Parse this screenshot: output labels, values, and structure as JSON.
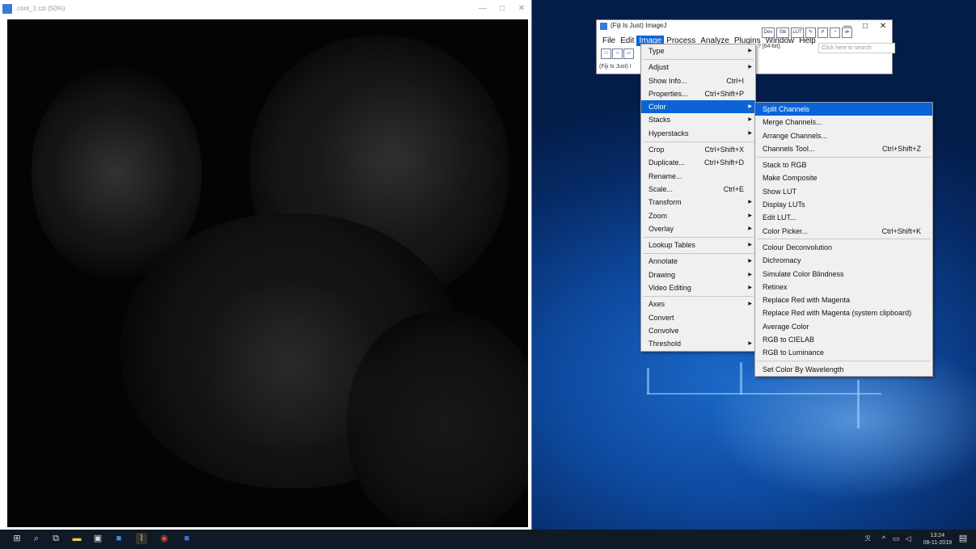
{
  "image_window": {
    "title": "cont_1.czi (50%)",
    "controls": {
      "minimize": "—",
      "maximize": "□",
      "close": "✕"
    }
  },
  "imagej_window": {
    "title": "(Fiji Is Just) ImageJ",
    "controls": {
      "minimize": "—",
      "maximize": "□",
      "close": "✕"
    },
    "menubar": [
      "File",
      "Edit",
      "Image",
      "Process",
      "Analyze",
      "Plugins",
      "Window",
      "Help"
    ],
    "active_menu": "Image",
    "status_left": "(Fiji Is Just) I",
    "status_right": "? [64-bit].",
    "search_placeholder": "Click here to search",
    "tools_right": [
      "Dev",
      "Stk",
      "LUT",
      "✎",
      "✐",
      "◔",
      "≫"
    ]
  },
  "image_menu": [
    {
      "label": "Type",
      "sub": true
    },
    {
      "sep": true
    },
    {
      "label": "Adjust",
      "sub": true
    },
    {
      "label": "Show Info...",
      "shortcut": "Ctrl+I"
    },
    {
      "label": "Properties...",
      "shortcut": "Ctrl+Shift+P"
    },
    {
      "label": "Color",
      "sub": true,
      "highlight": true
    },
    {
      "label": "Stacks",
      "sub": true
    },
    {
      "label": "Hyperstacks",
      "sub": true
    },
    {
      "sep": true
    },
    {
      "label": "Crop",
      "shortcut": "Ctrl+Shift+X"
    },
    {
      "label": "Duplicate...",
      "shortcut": "Ctrl+Shift+D"
    },
    {
      "label": "Rename..."
    },
    {
      "label": "Scale...",
      "shortcut": "Ctrl+E"
    },
    {
      "label": "Transform",
      "sub": true
    },
    {
      "label": "Zoom",
      "sub": true
    },
    {
      "label": "Overlay",
      "sub": true
    },
    {
      "sep": true
    },
    {
      "label": "Lookup Tables",
      "sub": true
    },
    {
      "sep": true
    },
    {
      "label": "Annotate",
      "sub": true
    },
    {
      "label": "Drawing",
      "sub": true
    },
    {
      "label": "Video Editing",
      "sub": true
    },
    {
      "sep": true
    },
    {
      "label": "Axes",
      "sub": true
    },
    {
      "label": "Convert"
    },
    {
      "label": "Convolve"
    },
    {
      "label": "Threshold",
      "sub": true
    }
  ],
  "color_submenu": [
    {
      "label": "Split Channels",
      "highlight": true
    },
    {
      "label": "Merge Channels..."
    },
    {
      "label": "Arrange Channels..."
    },
    {
      "label": "Channels Tool...",
      "shortcut": "Ctrl+Shift+Z"
    },
    {
      "sep": true
    },
    {
      "label": "Stack to RGB"
    },
    {
      "label": "Make Composite"
    },
    {
      "label": "Show LUT"
    },
    {
      "label": "Display LUTs"
    },
    {
      "label": "Edit LUT..."
    },
    {
      "label": "Color Picker...",
      "shortcut": "Ctrl+Shift+K"
    },
    {
      "sep": true
    },
    {
      "label": "Colour Deconvolution"
    },
    {
      "label": "Dichromacy"
    },
    {
      "label": "Simulate Color Blindness"
    },
    {
      "label": "Retinex"
    },
    {
      "label": "Replace Red with Magenta"
    },
    {
      "label": "Replace Red with Magenta (system clipboard)"
    },
    {
      "label": "Average Color"
    },
    {
      "label": "RGB to CIELAB"
    },
    {
      "label": "RGB to Luminance"
    },
    {
      "sep": true
    },
    {
      "label": "Set Color By Wavelength"
    }
  ],
  "taskbar": {
    "time": "13:24",
    "date": "08-11-2019",
    "icons": [
      "start-icon",
      "search-icon",
      "task-view-icon",
      "file-explorer-icon",
      "store-icon",
      "outlook-icon",
      "fiji-icon",
      "chrome-icon",
      "word-icon"
    ]
  }
}
